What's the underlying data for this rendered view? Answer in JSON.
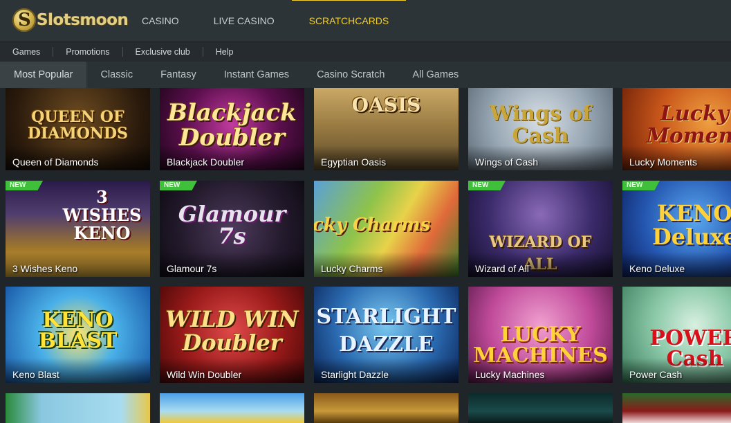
{
  "brand": {
    "name": "Slotsmoon",
    "colors": {
      "accent": "#f2cf2e",
      "new_badge": "#3fbf3a",
      "nav_text": "#c9cfd2"
    }
  },
  "main_nav": [
    {
      "label": "CASINO",
      "active": false
    },
    {
      "label": "LIVE CASINO",
      "active": false
    },
    {
      "label": "SCRATCHCARDS",
      "active": true
    }
  ],
  "sub_nav": [
    "Games",
    "Promotions",
    "Exclusive club",
    "Help"
  ],
  "category_tabs": [
    {
      "label": "Most Popular",
      "active": true
    },
    {
      "label": "Classic",
      "active": false
    },
    {
      "label": "Fantasy",
      "active": false
    },
    {
      "label": "Instant Games",
      "active": false
    },
    {
      "label": "Casino Scratch",
      "active": false
    },
    {
      "label": "All Games",
      "active": false
    }
  ],
  "games": [
    {
      "name": "Queen of Diamonds",
      "art_text": "QUEEN OF DIAMONDS",
      "is_new": false
    },
    {
      "name": "Blackjack Doubler",
      "art_text": "Blackjack Doubler",
      "is_new": false
    },
    {
      "name": "Egyptian Oasis",
      "art_text": "OASIS",
      "is_new": false
    },
    {
      "name": "Wings of Cash",
      "art_text": "Wings of Cash",
      "is_new": false
    },
    {
      "name": "Lucky Moments",
      "art_text": "Lucky Moment",
      "is_new": false
    },
    {
      "name": "3 Wishes Keno",
      "art_text": "3 WISHES KENO",
      "is_new": true
    },
    {
      "name": "Glamour 7s",
      "art_text": "Glamour 7s",
      "is_new": true
    },
    {
      "name": "Lucky Charms",
      "art_text": "Lucky Charms",
      "is_new": false
    },
    {
      "name": "Wizard of All",
      "art_text": "WIZARD OF ALL",
      "is_new": true
    },
    {
      "name": "Keno Deluxe",
      "art_text": "KENO Deluxe",
      "is_new": true
    },
    {
      "name": "Keno Blast",
      "art_text": "KENO BLAST",
      "is_new": false
    },
    {
      "name": "Wild Win Doubler",
      "art_text": "WILD WIN Doubler",
      "is_new": false
    },
    {
      "name": "Starlight Dazzle",
      "art_text": "STARLIGHT DAZZLE",
      "is_new": false
    },
    {
      "name": "Lucky Machines",
      "art_text": "LUCKY MACHINES",
      "is_new": false
    },
    {
      "name": "Power Cash",
      "art_text": "POWER Cash",
      "is_new": false
    }
  ],
  "badge_label": "NEW"
}
